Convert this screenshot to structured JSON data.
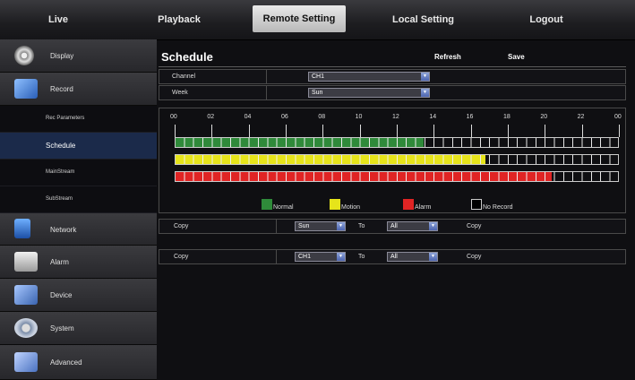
{
  "nav": {
    "tabs": [
      {
        "label": "Live"
      },
      {
        "label": "Playback"
      },
      {
        "label": "Remote Setting"
      },
      {
        "label": "Local Setting"
      },
      {
        "label": "Logout"
      }
    ],
    "active": "Remote Setting"
  },
  "sidebar": {
    "items": [
      {
        "label": "Display",
        "icon": "display-icon"
      },
      {
        "label": "Record",
        "icon": "record-icon"
      },
      {
        "label": "Network",
        "icon": "network-icon"
      },
      {
        "label": "Alarm",
        "icon": "alarm-icon"
      },
      {
        "label": "Device",
        "icon": "device-icon"
      },
      {
        "label": "System",
        "icon": "system-icon"
      },
      {
        "label": "Advanced",
        "icon": "advanced-icon"
      }
    ],
    "subitems": [
      {
        "label": "Rec Parameters"
      },
      {
        "label": "Schedule"
      },
      {
        "label": "MainStream"
      },
      {
        "label": "SubStream"
      }
    ],
    "active_sub": "Schedule"
  },
  "schedule": {
    "title": "Schedule",
    "refresh_label": "Refresh",
    "save_label": "Save",
    "channel_label": "Channel",
    "channel_value": "CH1",
    "week_label": "Week",
    "week_value": "Sun",
    "hour_labels": [
      "00",
      "02",
      "04",
      "06",
      "08",
      "10",
      "12",
      "14",
      "16",
      "18",
      "20",
      "22",
      "00"
    ],
    "bars": [
      {
        "name": "Normal",
        "color": "#2f8a3a",
        "fill_fraction": 0.56
      },
      {
        "name": "Motion",
        "color": "#e6e41a",
        "fill_fraction": 0.7
      },
      {
        "name": "Alarm",
        "color": "#e02424",
        "fill_fraction": 0.85
      }
    ],
    "legend": [
      {
        "label": "Normal",
        "color": "#2f8a3a"
      },
      {
        "label": "Motion",
        "color": "#e6e41a"
      },
      {
        "label": "Alarm",
        "color": "#e02424"
      },
      {
        "label": "No Record",
        "color": "#000000"
      }
    ],
    "copy_week": {
      "label": "Copy",
      "from": "Sun",
      "to_label": "To",
      "to": "All",
      "action": "Copy"
    },
    "copy_channel": {
      "label": "Copy",
      "from": "CH1",
      "to_label": "To",
      "to": "All",
      "action": "Copy"
    }
  }
}
